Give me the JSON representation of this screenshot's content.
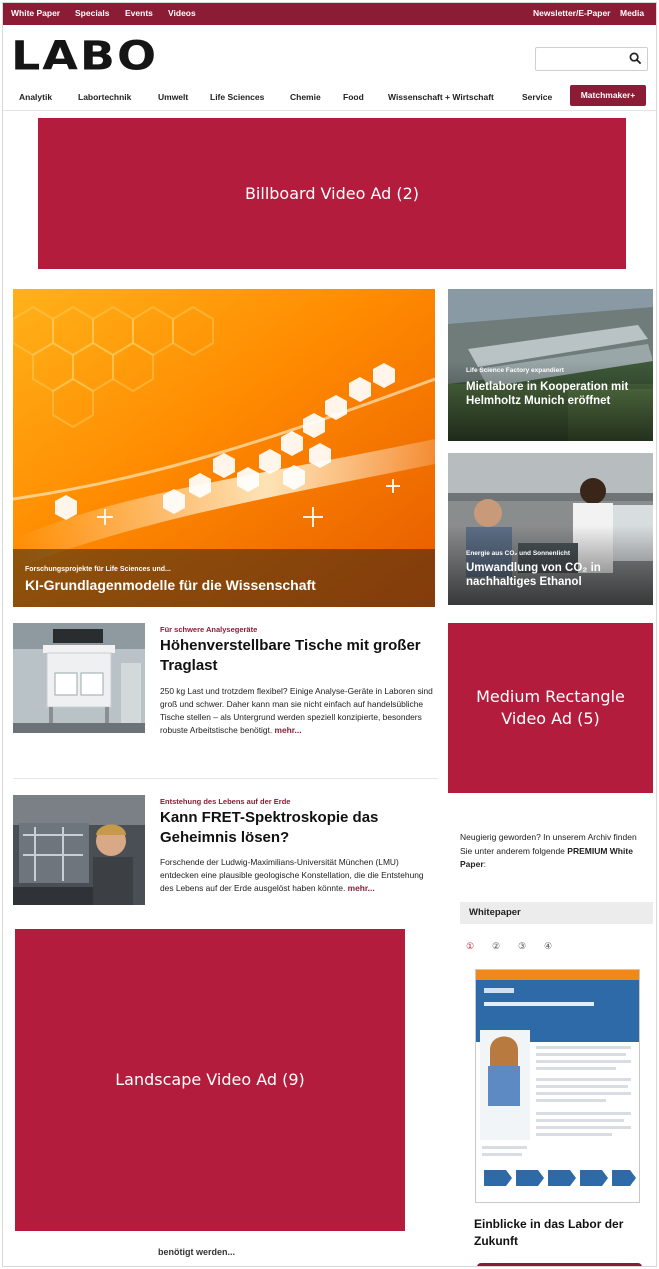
{
  "topbar": {
    "left": [
      "White Paper",
      "Specials",
      "Events",
      "Videos"
    ],
    "right": [
      "Newsletter/E-Paper",
      "Media"
    ]
  },
  "brand": {
    "logo": "LABO"
  },
  "search": {
    "placeholder": "",
    "icon": "search-icon"
  },
  "nav": {
    "items": [
      "Analytik",
      "Labortechnik",
      "Umwelt",
      "Life Sciences",
      "Chemie",
      "Food",
      "Wissenschaft + Wirtschaft",
      "Service"
    ],
    "cta": "Matchmaker+"
  },
  "ads": {
    "billboard": "Billboard Video Ad (2)",
    "medium_rectangle": "Medium Rectangle Video Ad (5)",
    "landscape": "Landscape Video Ad (9)"
  },
  "hero": {
    "kicker": "Forschungsprojekte für Life Sciences und...",
    "title": "KI-Grundlagenmodelle für die Wissenschaft"
  },
  "side_stories": [
    {
      "kicker": "Life Science Factory expandiert",
      "title": "Mietlabore in Kooperation mit Helmholtz Munich eröffnet"
    },
    {
      "kicker": "Energie aus CO₂ und Sonnenlicht",
      "title": "Umwandlung von CO₂ in nachhaltiges Ethanol"
    }
  ],
  "articles": [
    {
      "kicker": "Für schwere Analysegeräte",
      "title": "Höhenverstellbare Tische mit großer Traglast",
      "body": "250 kg Last und trotzdem flexibel? Einige Analyse-Geräte in Laboren sind groß und schwer. Daher kann man sie nicht einfach auf handelsübliche Tische stellen – als Untergrund werden speziell konzipierte, besonders robuste Arbeitstische benötigt.",
      "more": "mehr..."
    },
    {
      "kicker": "Entstehung des Lebens auf der Erde",
      "title": "Kann FRET-Spektroskopie das Geheimnis lösen?",
      "body": "Forschende der Ludwig-Maximilians-Universität München (LMU) entdecken eine plausible geologische Konstellation, die die Entstehung des Lebens auf der Erde ausgelöst haben könnte.",
      "more": "mehr..."
    }
  ],
  "archive": {
    "text": "Neugierig geworden? In unserem Archiv finden Sie unter anderem folgende",
    "strong": "PREMIUM White Paper",
    "suffix": ":"
  },
  "whitepaper": {
    "heading": "Whitepaper",
    "pager": [
      "①",
      "②",
      "③",
      "④"
    ],
    "title": "Einblicke in das Labor der Zukunft"
  },
  "cut_text": "benötigt werden...",
  "colors": {
    "brand": "#8c1c35",
    "ad": "#b31c3c"
  }
}
